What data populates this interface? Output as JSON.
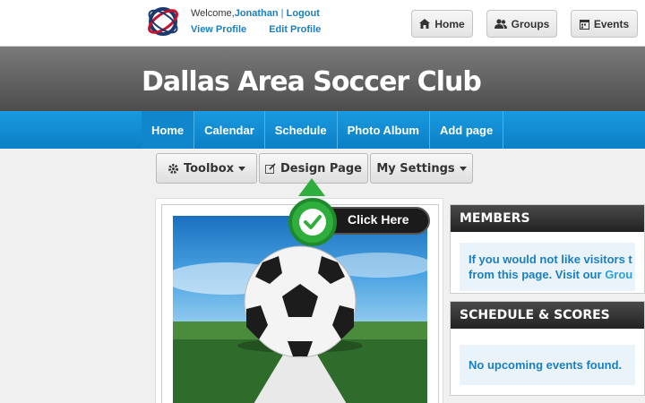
{
  "user": {
    "welcome_prefix": "Welcome,",
    "name": "Jonathan",
    "separator": "|",
    "logout": "Logout",
    "view_profile": "View Profile",
    "edit_profile": "Edit Profile"
  },
  "top_buttons": {
    "home": "Home",
    "groups": "Groups",
    "events": "Events"
  },
  "site": {
    "title": "Dallas Area Soccer Club"
  },
  "nav": {
    "items": [
      {
        "label": "Home"
      },
      {
        "label": "Calendar"
      },
      {
        "label": "Schedule"
      },
      {
        "label": "Photo Album"
      },
      {
        "label": "Add page"
      }
    ]
  },
  "toolbar": {
    "toolbox": "Toolbox",
    "design_page": "Design Page",
    "my_settings": "My Settings"
  },
  "callout": {
    "text": "Click Here"
  },
  "sidebar": {
    "members": {
      "title": "MEMBERS",
      "line1": "If you would not like visitors t",
      "line2_prefix": "from this page. Visit our ",
      "line2_link": "Grou"
    },
    "schedule": {
      "title": "SCHEDULE & SCORES",
      "empty": "No upcoming events found."
    }
  },
  "colors": {
    "nav_blue": "#0b7fc6",
    "link_blue": "#1a7fc1",
    "header_dark": "#4d4d4d",
    "accent_green": "#2fae3d"
  }
}
